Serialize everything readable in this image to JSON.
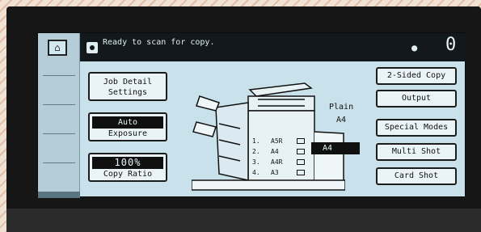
{
  "status": {
    "message": "Ready to scan for copy.",
    "copy_count": "0"
  },
  "home": {
    "icon": "home-icon"
  },
  "buttons": {
    "job_detail": [
      "Job Detail",
      "Settings"
    ],
    "exposure": {
      "mode": "Auto",
      "label": "Exposure"
    },
    "ratio": {
      "value": "100%",
      "label": "Copy Ratio"
    }
  },
  "paper": {
    "type": "Plain",
    "size": "A4",
    "selected": "A4"
  },
  "trays": [
    {
      "num": "1.",
      "size": "A5R"
    },
    {
      "num": "2.",
      "size": "A4"
    },
    {
      "num": "3.",
      "size": "A4R"
    },
    {
      "num": "4.",
      "size": "A3"
    }
  ],
  "right_buttons": [
    "2-Sided Copy",
    "Output",
    "Special Modes",
    "Multi Shot",
    "Card Shot"
  ],
  "colors": {
    "screen": "#c9e1ea",
    "ink": "#111111"
  }
}
